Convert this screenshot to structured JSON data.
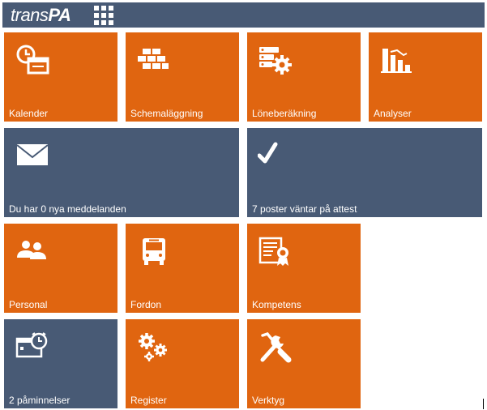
{
  "app": {
    "brand_light": "trans",
    "brand_bold": "PA",
    "apps_icon": "grid-icon"
  },
  "colors": {
    "orange": "#e06510",
    "slate": "#485a75",
    "white": "#ffffff"
  },
  "tiles": {
    "kalender": {
      "label": "Kalender",
      "icon": "calendar-clock-icon"
    },
    "schemalaggning": {
      "label": "Schemaläggning",
      "icon": "bricks-icon"
    },
    "loneberakning": {
      "label": "Löneberäkning",
      "icon": "server-gear-icon"
    },
    "analyser": {
      "label": "Analyser",
      "icon": "bar-chart-icon"
    },
    "meddelanden": {
      "label": "Du har 0 nya meddelanden",
      "icon": "envelope-icon"
    },
    "attest": {
      "label": "7 poster väntar på attest",
      "icon": "checkmark-icon"
    },
    "personal": {
      "label": "Personal",
      "icon": "people-icon"
    },
    "fordon": {
      "label": "Fordon",
      "icon": "bus-icon"
    },
    "kompetens": {
      "label": "Kompetens",
      "icon": "certificate-icon"
    },
    "paminnelser": {
      "label": "2 påminnelser",
      "icon": "alarm-window-icon"
    },
    "register": {
      "label": "Register",
      "icon": "gears-icon"
    },
    "verktyg": {
      "label": "Verktyg",
      "icon": "tools-icon"
    }
  }
}
